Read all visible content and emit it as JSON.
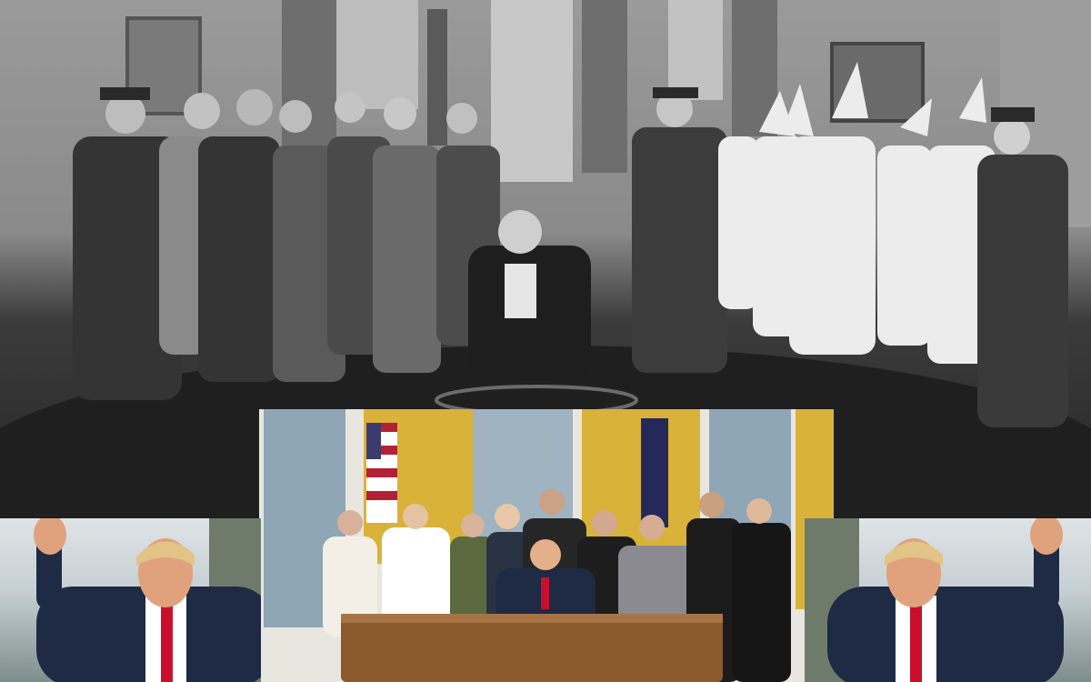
{
  "image": {
    "panels": [
      {
        "id": "bw-group-photo",
        "tone": "black-and-white"
      },
      {
        "id": "color-oval-office-photo",
        "tone": "color"
      },
      {
        "id": "left-waving-portrait",
        "tone": "color"
      },
      {
        "id": "right-waving-portrait",
        "tone": "color"
      }
    ],
    "colors": {
      "bw_floor": "#262626",
      "bw_wall": "#8f8f8f",
      "bw_robe": "#ececec",
      "bw_uniform": "#3a3a3a",
      "gold_curtain": "#d9b23a",
      "desk_wood": "#8a5a2c",
      "suit_navy": "#1f2a44",
      "tie_red": "#c8102e",
      "flag_red": "#b22234",
      "flag_blue": "#3c3b6e"
    }
  }
}
